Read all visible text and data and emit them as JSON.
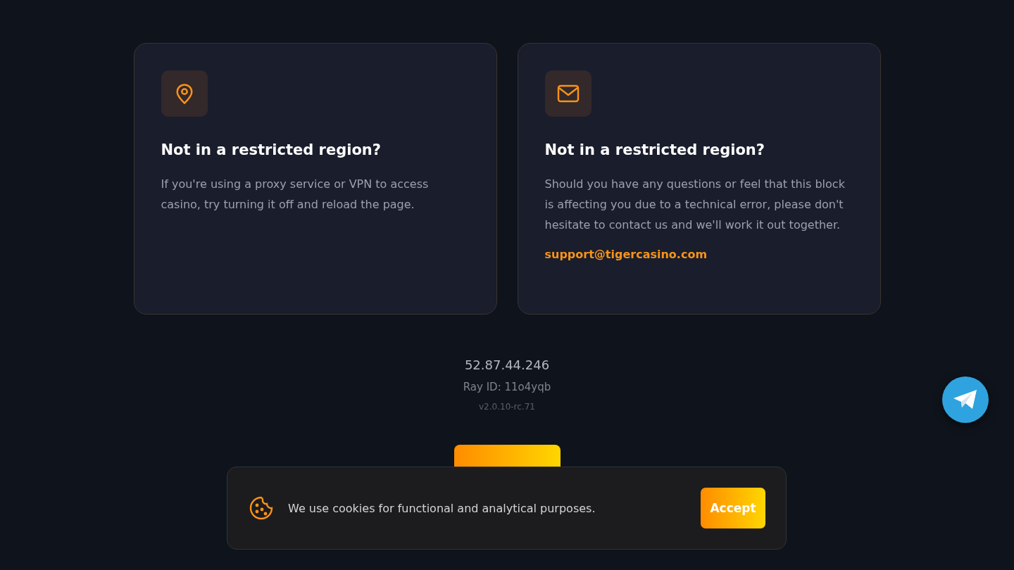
{
  "cards": [
    {
      "kind": "location",
      "title": "Not in a restricted region?",
      "body": "If you're using a proxy service or VPN to access casino, try turning it off and reload the page."
    },
    {
      "kind": "mail",
      "title": "Not in a restricted region?",
      "body": "Should you have any questions or feel that this block is affecting you due to a technical error, please don't hesitate to contact us and we'll work it out together.",
      "link": "support@tigercasino.com"
    }
  ],
  "ip": "52.87.44.246",
  "ray_id": "Ray ID: 11o4yqb",
  "version": "v2.0.10-rc.71",
  "cookie_banner": {
    "text": "We use cookies for functional and analytical purposes.",
    "button": "Accept"
  }
}
